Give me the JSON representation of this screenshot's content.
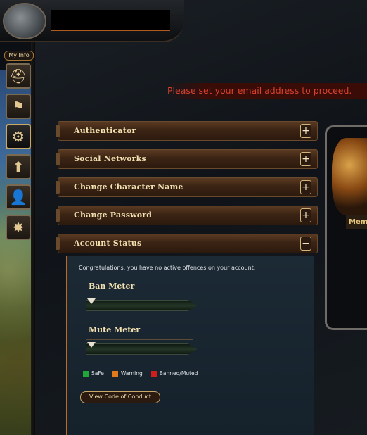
{
  "header": {
    "player_name": ""
  },
  "sidebar": {
    "tag_label": "My Info",
    "tabs": [
      {
        "icon": "helmet-icon",
        "glyph": "⛑"
      },
      {
        "icon": "banner-icon",
        "glyph": "⚑"
      },
      {
        "icon": "gear-icon",
        "glyph": "⚙"
      },
      {
        "icon": "skills-upgrade-icon",
        "glyph": "⬆"
      },
      {
        "icon": "add-friend-icon",
        "glyph": "👤"
      },
      {
        "icon": "grenade-icon",
        "glyph": "✸"
      }
    ]
  },
  "notice": {
    "email_message": "Please set your email address to proceed."
  },
  "right_panel": {
    "label": "Mem"
  },
  "sections": [
    {
      "label": "Authenticator",
      "toggle": "+"
    },
    {
      "label": "Social Networks",
      "toggle": "+"
    },
    {
      "label": "Change Character Name",
      "toggle": "+"
    },
    {
      "label": "Change Password",
      "toggle": "+"
    },
    {
      "label": "Account Status",
      "toggle": "−"
    }
  ],
  "account_status": {
    "message": "Congratulations, you have no active offences on your account.",
    "ban_meter_label": "Ban Meter",
    "ban_meter_level": 0,
    "mute_meter_label": "Mute Meter",
    "mute_meter_level": 0,
    "legend": [
      {
        "label": "SaFe",
        "color": "#1fa83a"
      },
      {
        "label": "Warning",
        "color": "#e07a1a"
      },
      {
        "label": "Banned/Muted",
        "color": "#d01e1e"
      }
    ],
    "code_of_conduct_button": "View Code of Conduct"
  },
  "colors": {
    "notice_text": "#d8422e",
    "section_text": "#f3e0b0",
    "accent_orange": "#c06a1e"
  }
}
